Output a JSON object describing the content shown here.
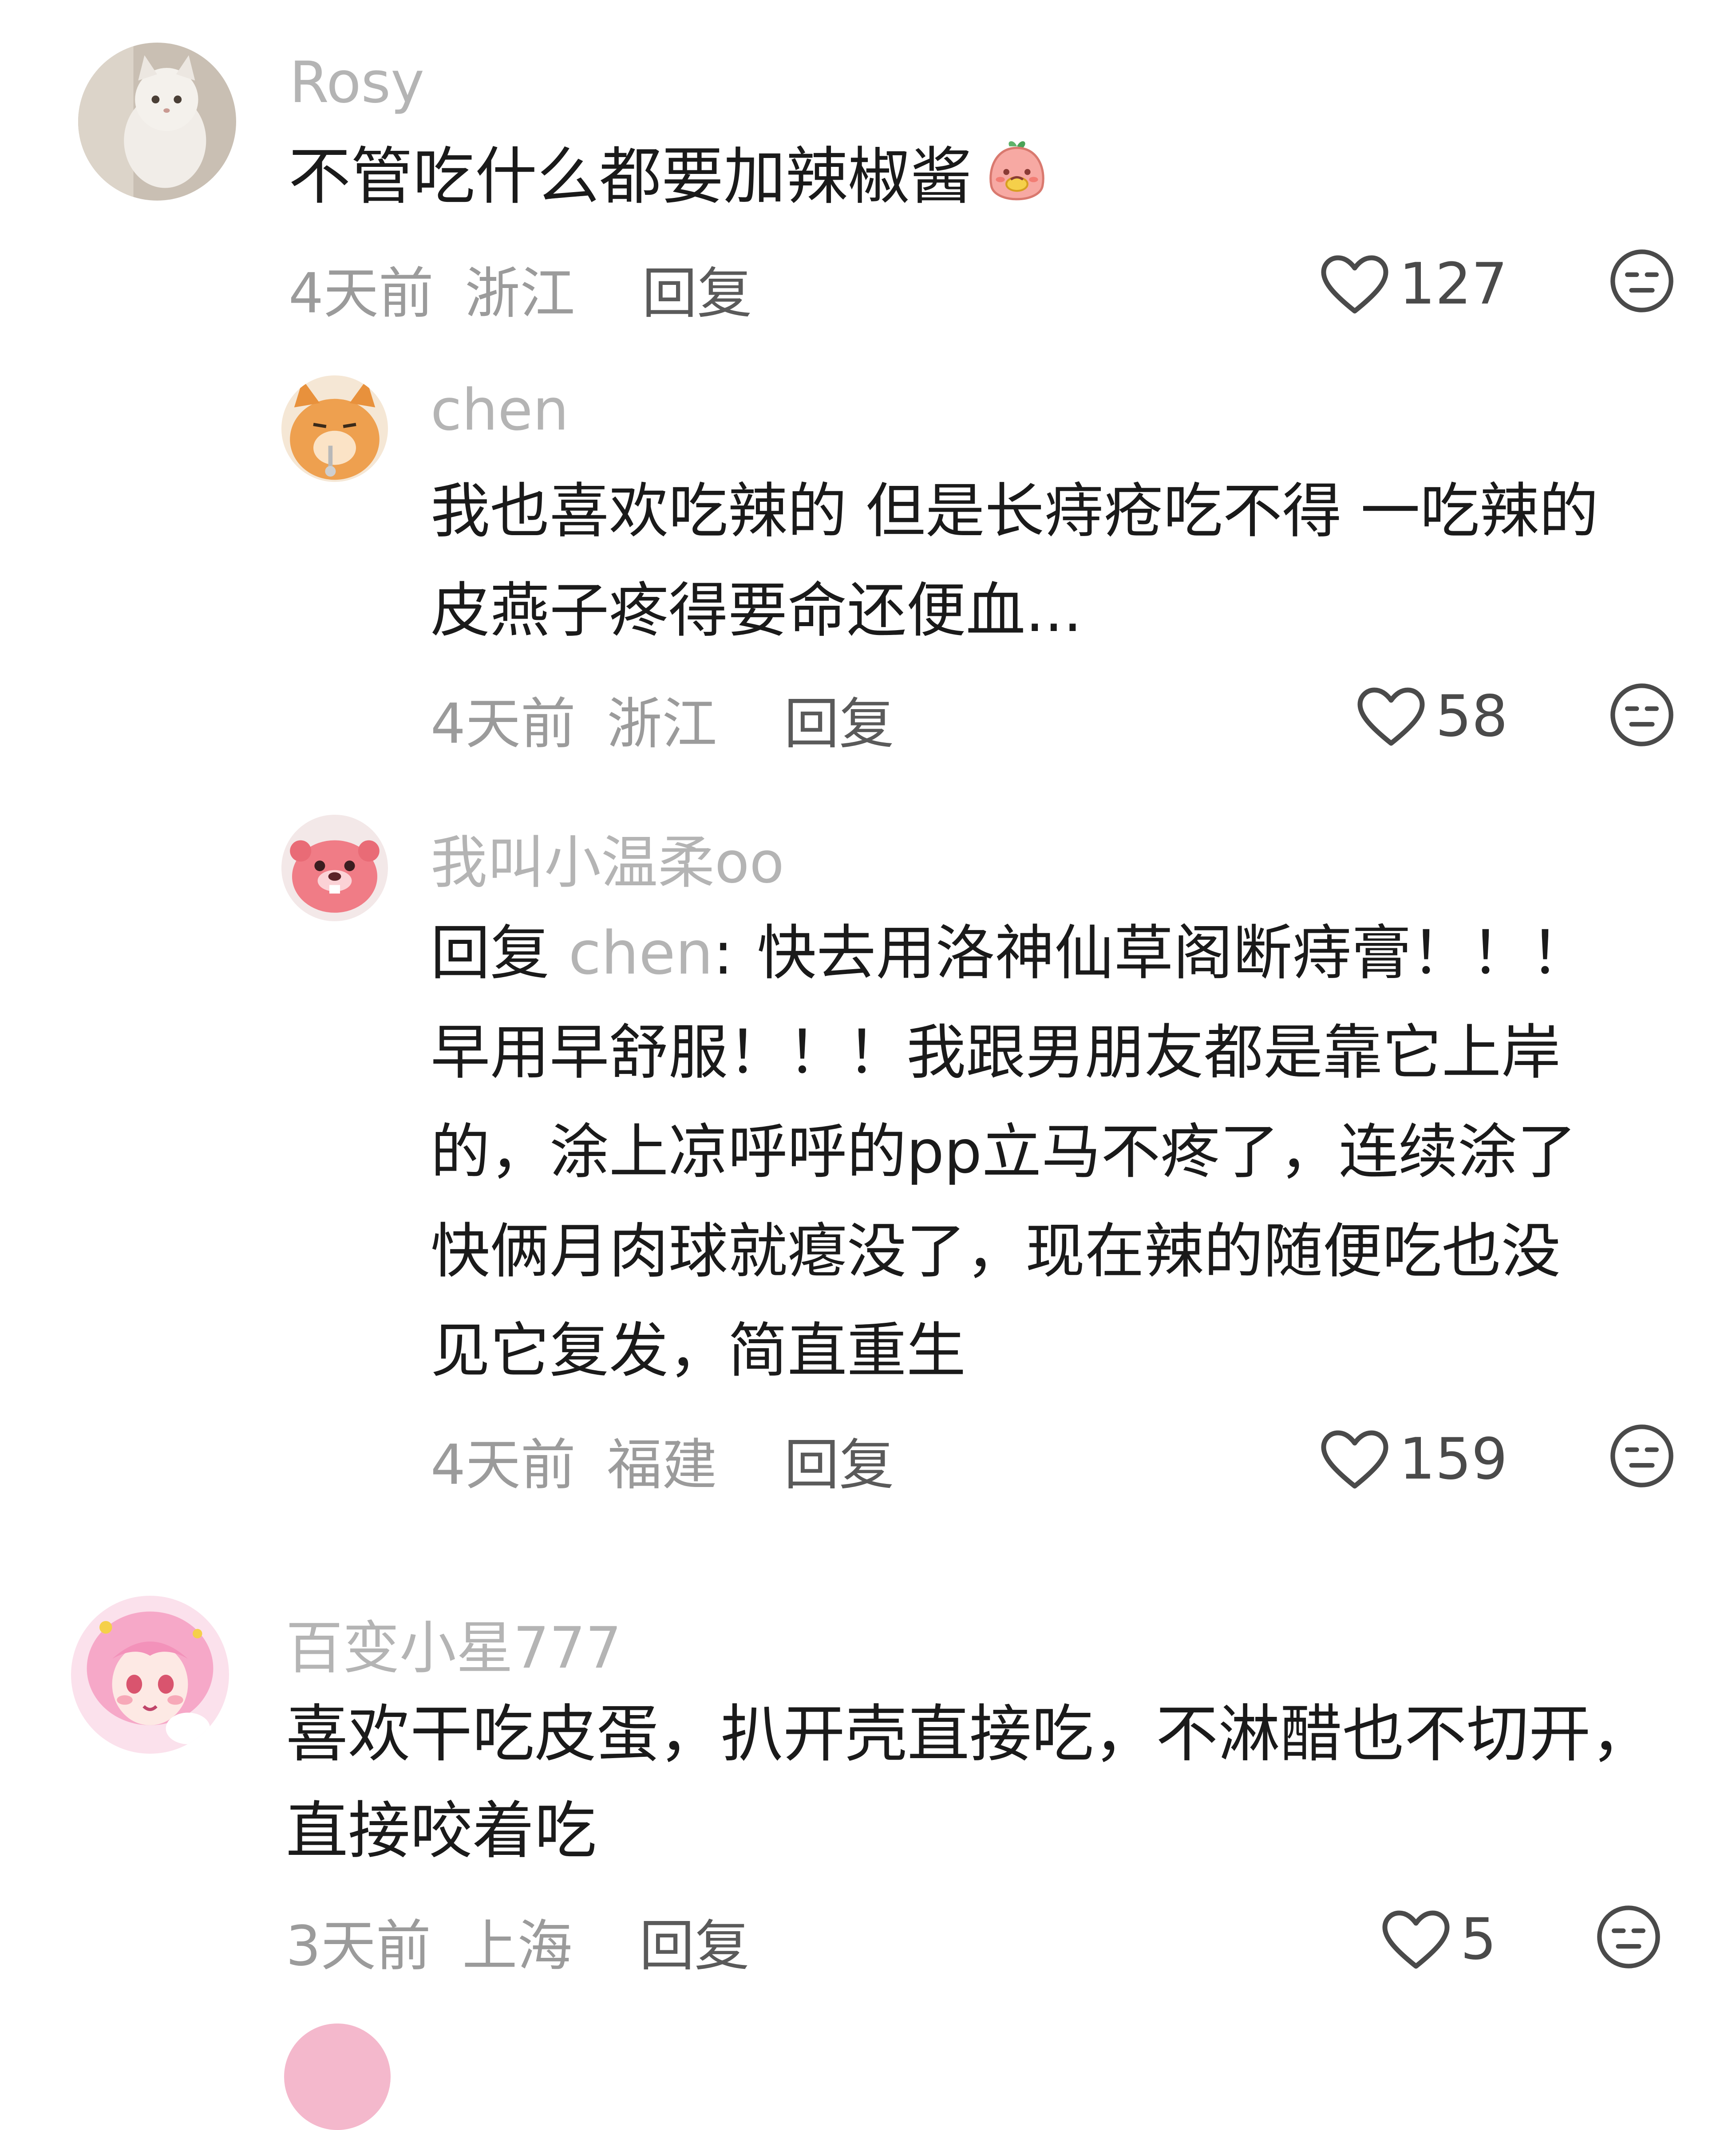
{
  "comments": [
    {
      "user": "Rosy",
      "lines": [
        "不管吃什么都要加辣椒酱"
      ],
      "time": "4天前",
      "location": "浙江",
      "reply_label": "回复",
      "likes": "127",
      "avatar_icon": "cat-avatar-icon",
      "emoji_icon": "peach-emoji-icon"
    },
    {
      "user": "chen",
      "lines": [
        "我也喜欢吃辣的 但是长痔疮吃不得 一吃辣的",
        "皮燕子疼得要命还便血..."
      ],
      "time": "4天前",
      "location": "浙江",
      "reply_label": "回复",
      "likes": "58",
      "avatar_icon": "orange-cat-avatar-icon"
    },
    {
      "user": "我叫小温柔oo",
      "reply_prefix": "回复",
      "reply_to": "chen",
      "reply_colon": ":",
      "lines": [
        "快去用洛神仙草阁断痔膏！！！",
        "早用早舒服！！！我跟男朋友都是靠它上岸",
        "的，涂上凉呼呼的pp立马不疼了，连续涂了",
        "快俩月肉球就瘪没了，现在辣的随便吃也没",
        "见它复发，简直重生"
      ],
      "time": "4天前",
      "location": "福建",
      "reply_label": "回复",
      "likes": "159",
      "avatar_icon": "pink-beaver-avatar-icon"
    },
    {
      "user": "百变小星777",
      "lines": [
        "喜欢干吃皮蛋，扒开壳直接吃，不淋醋也不切开，",
        "直接咬着吃"
      ],
      "time": "3天前",
      "location": "上海",
      "reply_label": "回复",
      "likes": "5",
      "avatar_icon": "anime-girl-avatar-icon"
    }
  ],
  "colors": {
    "username": "#b4b4b4",
    "text": "#1a1a1a",
    "meta": "#9b9b9b",
    "reply": "#5a5a5a",
    "icon": "#4a4a4a"
  }
}
